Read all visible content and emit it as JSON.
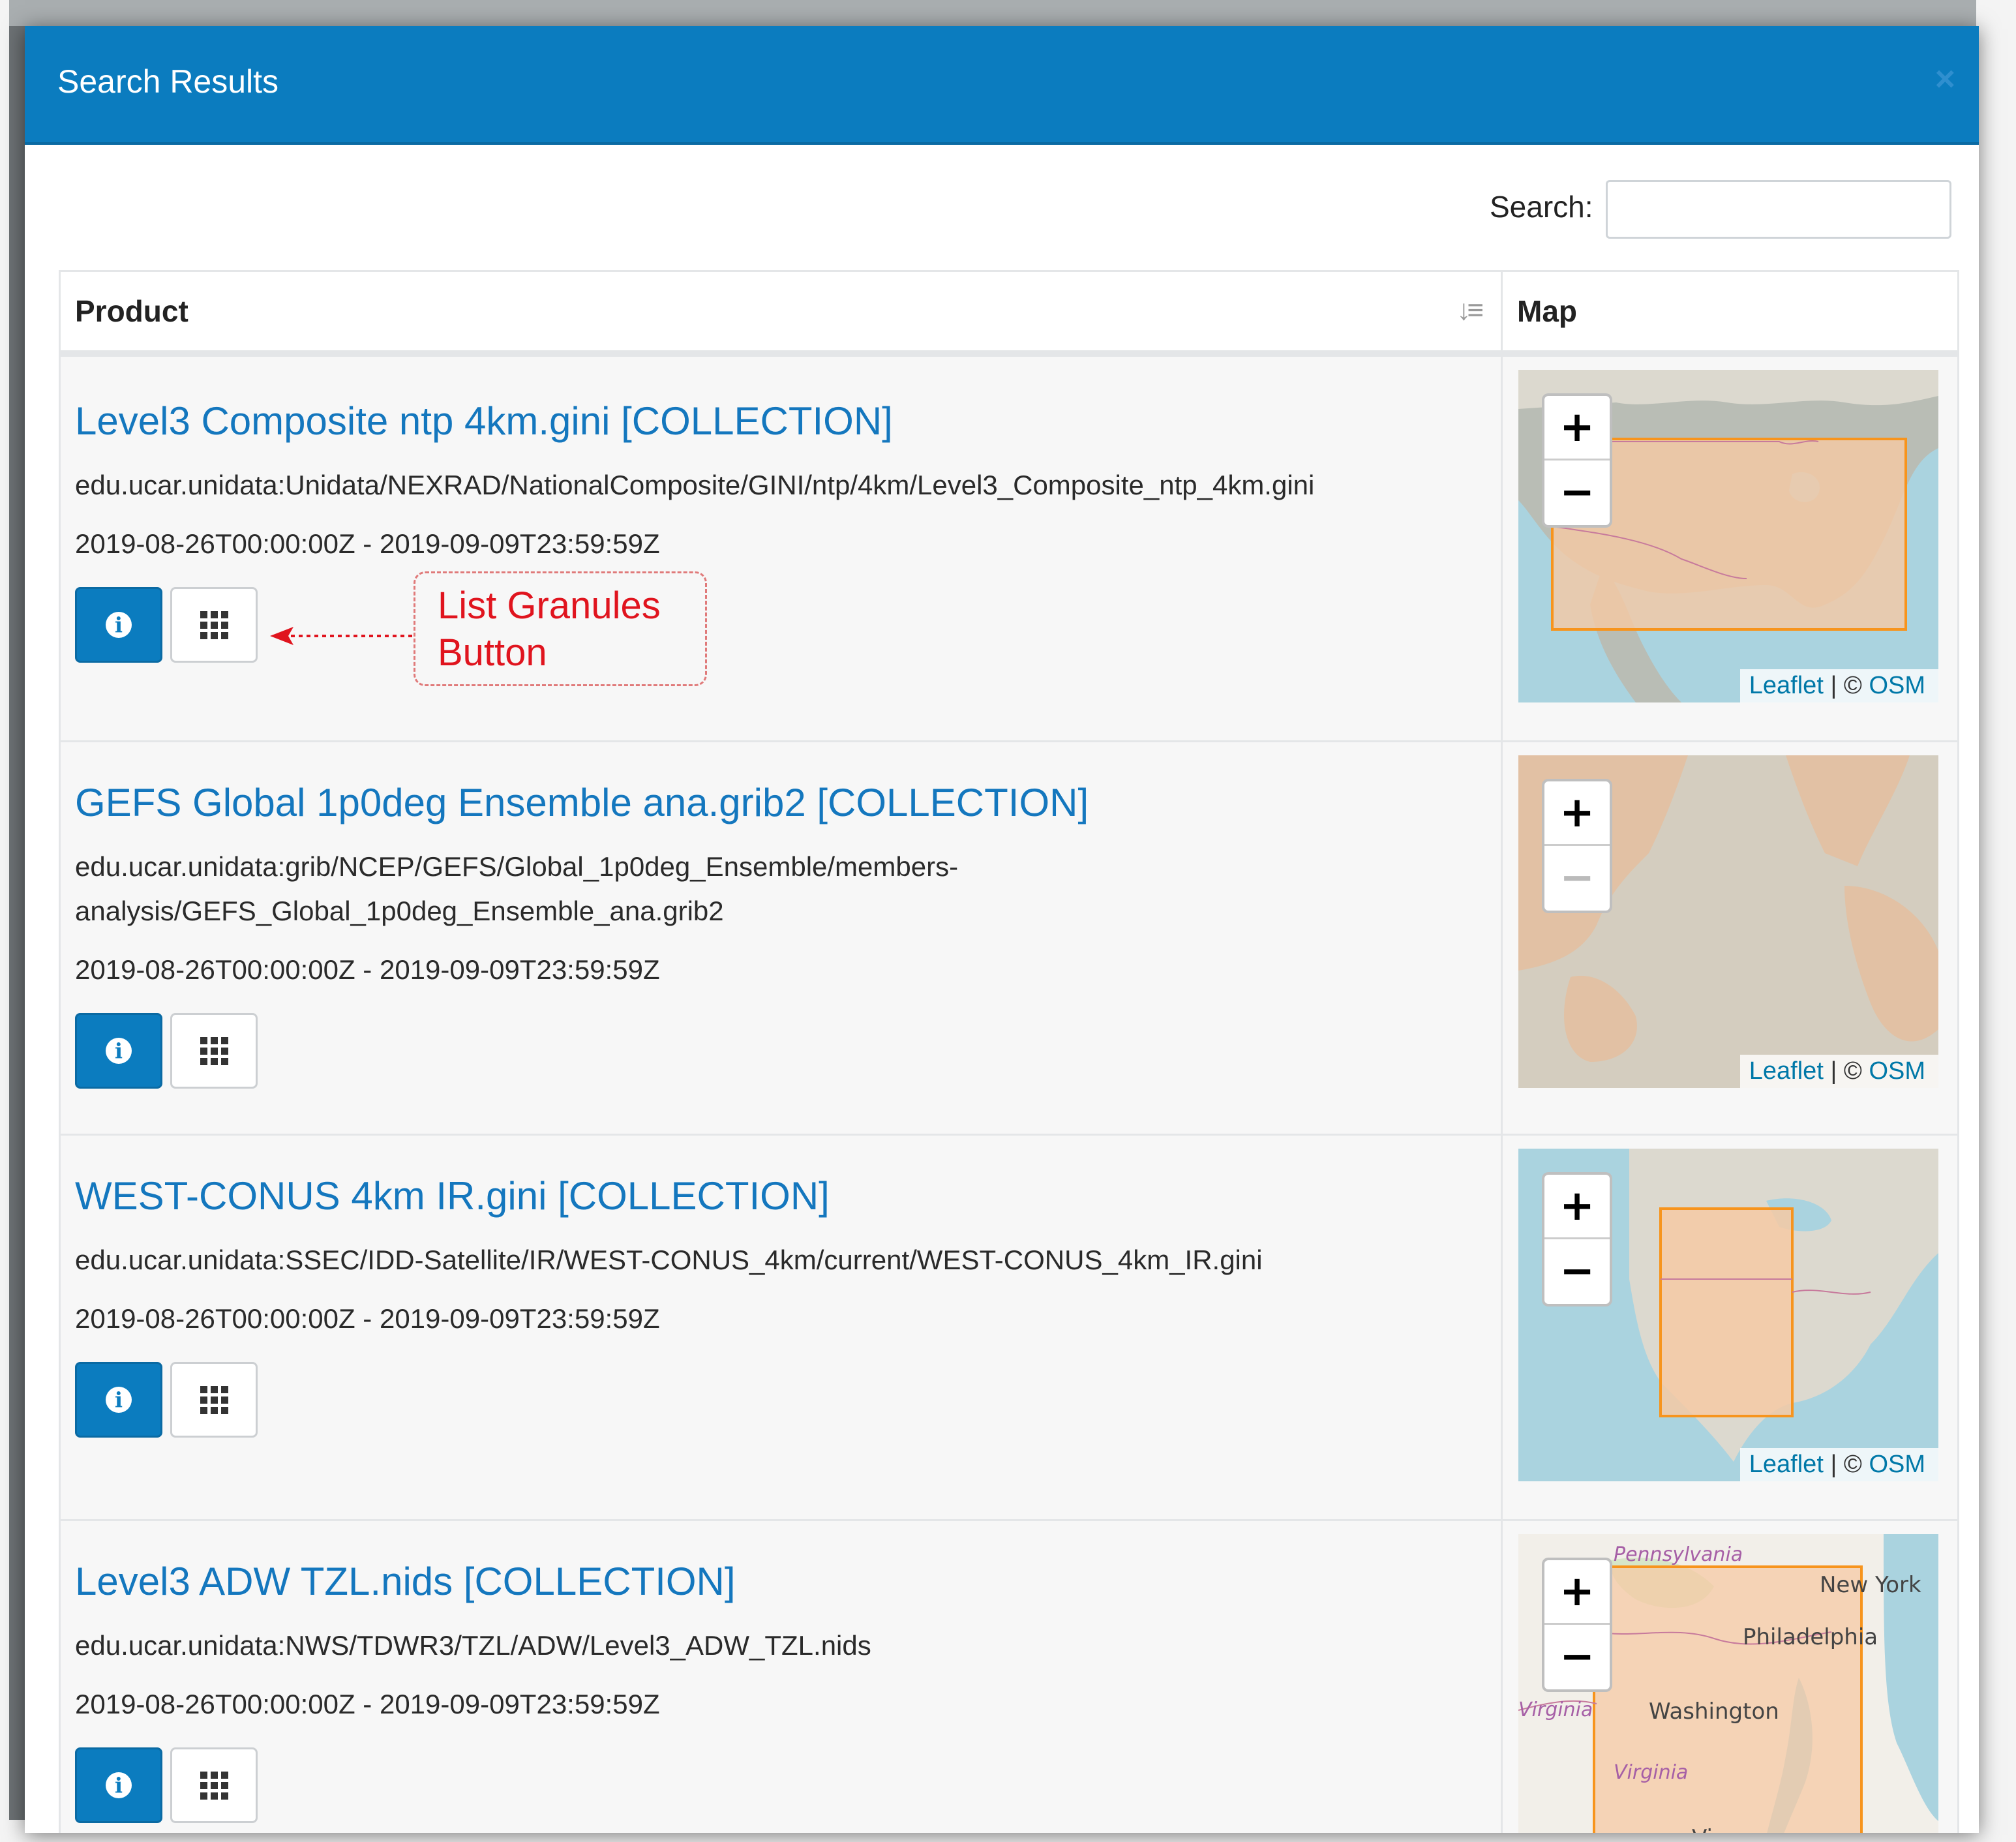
{
  "modal": {
    "title": "Search Results",
    "close_icon": "×"
  },
  "search": {
    "label": "Search:",
    "value": "",
    "placeholder": ""
  },
  "table": {
    "headers": {
      "product": "Product",
      "map": "Map"
    }
  },
  "results": [
    {
      "title": "Level3 Composite ntp 4km.gini [COLLECTION]",
      "id": "edu.ucar.unidata:Unidata/NEXRAD/NationalComposite/GINI/ntp/4km/Level3_Composite_ntp_4km.gini",
      "time": "2019-08-26T00:00:00Z - 2019-09-09T23:59:59Z"
    },
    {
      "title": "GEFS Global 1p0deg Ensemble ana.grib2 [COLLECTION]",
      "id": "edu.ucar.unidata:grib/NCEP/GEFS/Global_1p0deg_Ensemble/members-analysis/GEFS_Global_1p0deg_Ensemble_ana.grib2",
      "time": "2019-08-26T00:00:00Z - 2019-09-09T23:59:59Z"
    },
    {
      "title": "WEST-CONUS 4km IR.gini [COLLECTION]",
      "id": "edu.ucar.unidata:SSEC/IDD-Satellite/IR/WEST-CONUS_4km/current/WEST-CONUS_4km_IR.gini",
      "time": "2019-08-26T00:00:00Z - 2019-09-09T23:59:59Z"
    },
    {
      "title": "Level3 ADW TZL.nids [COLLECTION]",
      "id": "edu.ucar.unidata:NWS/TDWR3/TZL/ADW/Level3_ADW_TZL.nids",
      "time": "2019-08-26T00:00:00Z - 2019-09-09T23:59:59Z"
    }
  ],
  "map_controls": {
    "zoom_in": "+",
    "zoom_out": "−",
    "leaflet": "Leaflet",
    "separator": "|",
    "osm_prefix": "©",
    "osm": "OSM"
  },
  "map_labels": {
    "pennsylvania": "Pennsylvania",
    "new_york": "New York",
    "philadelphia": "Philadelphia",
    "washington": "Washington",
    "virginia_west": "Virginia",
    "virginia": "Virginia",
    "virginia_beach": "Virg"
  },
  "annotation": {
    "line1": "List Granules",
    "line2": "Button"
  },
  "colors": {
    "header": "#0b7cbf",
    "link": "#1477be",
    "bbox_fill": "#f6c9a4",
    "bbox_stroke": "#f7941d",
    "annotation": "#e0141e"
  },
  "icons": {
    "info": "info-circle-icon",
    "grid": "grid-icon",
    "sort": "sort-amount-icon",
    "close": "close-icon"
  }
}
